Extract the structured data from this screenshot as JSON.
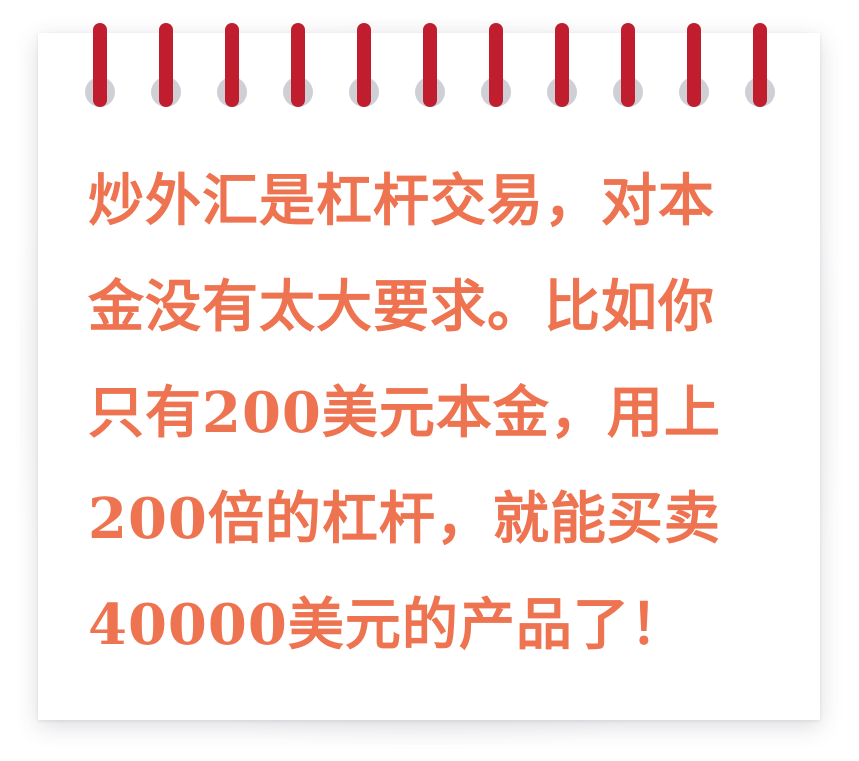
{
  "colors": {
    "text": "#ee7350",
    "ring": "#c01d2e",
    "ring_hole": "#cfd0d6",
    "card": "#ffffff"
  },
  "note": {
    "lines": [
      "炒外汇是杠杆交易，对本",
      "金没有太大要求。比如你",
      "只有200美元本金，用上",
      "200倍的杠杆，就能买卖",
      "40000美元的产品了！"
    ]
  }
}
